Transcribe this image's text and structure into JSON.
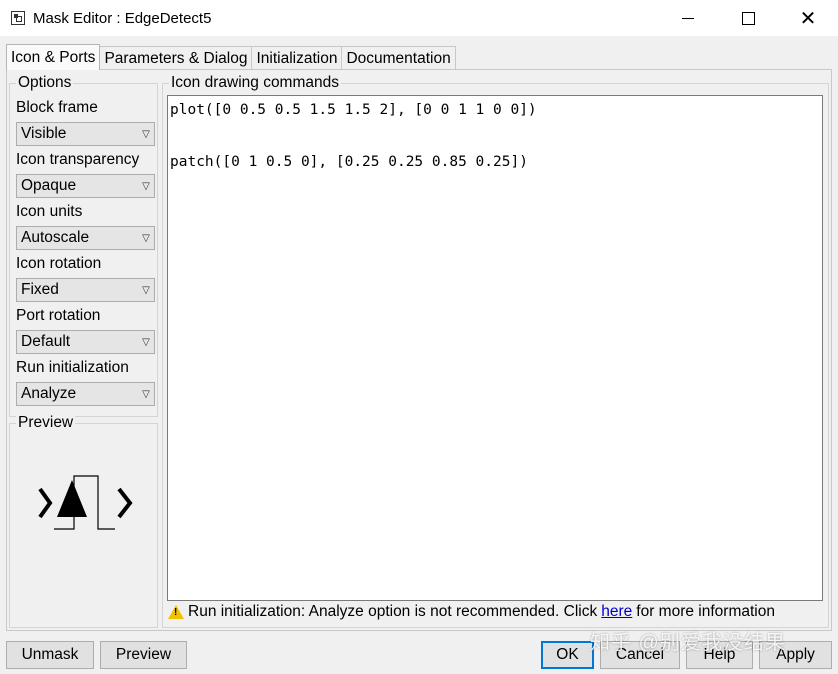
{
  "window": {
    "title": "Mask Editor : EdgeDetect5",
    "icon": "mask-editor-icon",
    "controls": [
      "minimize-icon",
      "maximize-icon",
      "close-icon"
    ]
  },
  "tabs": [
    {
      "label": "Icon & Ports",
      "active": true
    },
    {
      "label": "Parameters & Dialog",
      "active": false
    },
    {
      "label": "Initialization",
      "active": false
    },
    {
      "label": "Documentation",
      "active": false
    }
  ],
  "options": {
    "title": "Options",
    "block_frame": {
      "label": "Block frame",
      "value": "Visible"
    },
    "icon_transparency": {
      "label": "Icon transparency",
      "value": "Opaque"
    },
    "icon_units": {
      "label": "Icon units",
      "value": "Autoscale"
    },
    "icon_rotation": {
      "label": "Icon rotation",
      "value": "Fixed"
    },
    "port_rotation": {
      "label": "Port rotation",
      "value": "Default"
    },
    "run_initialization": {
      "label": "Run initialization",
      "value": "Analyze"
    }
  },
  "preview": {
    "title": "Preview"
  },
  "drawing": {
    "title": "Icon drawing commands",
    "lines": [
      "plot([0 0.5 0.5 1.5 1.5 2], [0 0 1 1 0 0])",
      "",
      "patch([0 1 0.5 0], [0.25 0.25 0.85 0.25])"
    ]
  },
  "warning": {
    "text_before": "Run initialization: Analyze option is not recommended. Click",
    "link": "here",
    "text_after": "for more information"
  },
  "buttons": {
    "unmask": "Unmask",
    "preview": "Preview",
    "ok": "OK",
    "cancel": "Cancel",
    "help": "Help",
    "apply": "Apply"
  },
  "watermark": "知乎 @别爱我没结果",
  "colors": {
    "link": "#0000cc",
    "default_button_border": "#0078d7",
    "warning": "#f2c100"
  }
}
